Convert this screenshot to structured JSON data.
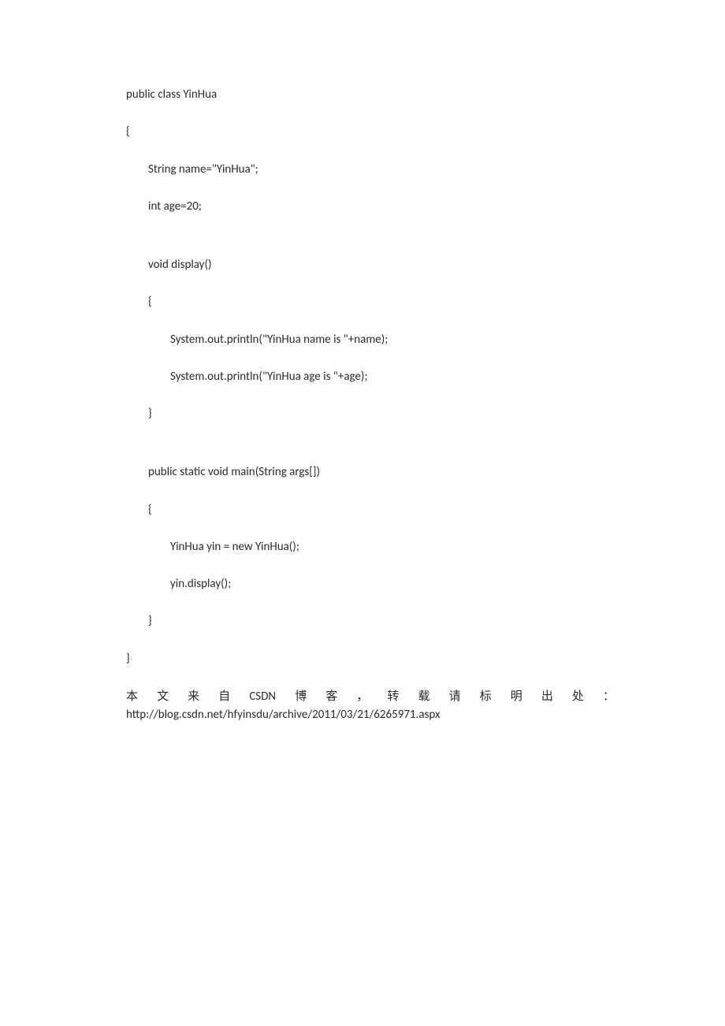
{
  "code": {
    "l01": "public class YinHua ",
    "l02": "{ ",
    "l03": "String name=\"YinHua\"; ",
    "l04": "int age=20; ",
    "l05": "void display() ",
    "l06": "{ ",
    "l07": "System.out.println(\"YinHua name is \"+name);    ",
    "l08": "System.out.println(\"YinHua age is \"+age); ",
    "l09": "} ",
    "l10": "public static void main(String args[]) ",
    "l11": "{ ",
    "l12": "YinHua yin = new YinHua(); ",
    "l13": "yin.display(); ",
    "l14": "} ",
    "l15": "}"
  },
  "attribution": {
    "cjk": [
      "本",
      "文",
      "来",
      "自",
      "CSDN",
      "博",
      "客",
      "，",
      "转",
      "载",
      "请",
      "标",
      "明",
      "出",
      "处",
      "："
    ],
    "url": "http://blog.csdn.net/hfyinsdu/archive/2011/03/21/6265971.aspx"
  }
}
